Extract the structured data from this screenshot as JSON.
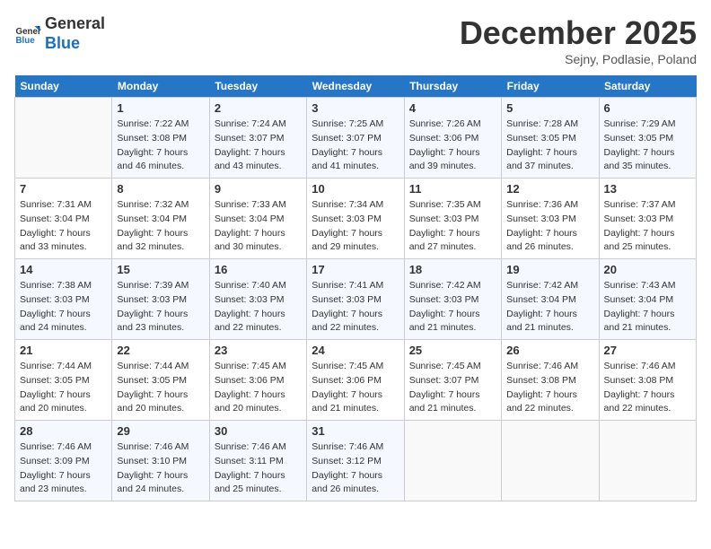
{
  "header": {
    "logo_line1": "General",
    "logo_line2": "Blue",
    "month": "December 2025",
    "location": "Sejny, Podlasie, Poland"
  },
  "days_of_week": [
    "Sunday",
    "Monday",
    "Tuesday",
    "Wednesday",
    "Thursday",
    "Friday",
    "Saturday"
  ],
  "weeks": [
    [
      {
        "day": "",
        "empty": true
      },
      {
        "day": "1",
        "sunrise": "7:22 AM",
        "sunset": "3:08 PM",
        "daylight": "7 hours and 46 minutes."
      },
      {
        "day": "2",
        "sunrise": "7:24 AM",
        "sunset": "3:07 PM",
        "daylight": "7 hours and 43 minutes."
      },
      {
        "day": "3",
        "sunrise": "7:25 AM",
        "sunset": "3:07 PM",
        "daylight": "7 hours and 41 minutes."
      },
      {
        "day": "4",
        "sunrise": "7:26 AM",
        "sunset": "3:06 PM",
        "daylight": "7 hours and 39 minutes."
      },
      {
        "day": "5",
        "sunrise": "7:28 AM",
        "sunset": "3:05 PM",
        "daylight": "7 hours and 37 minutes."
      },
      {
        "day": "6",
        "sunrise": "7:29 AM",
        "sunset": "3:05 PM",
        "daylight": "7 hours and 35 minutes."
      }
    ],
    [
      {
        "day": "7",
        "sunrise": "7:31 AM",
        "sunset": "3:04 PM",
        "daylight": "7 hours and 33 minutes."
      },
      {
        "day": "8",
        "sunrise": "7:32 AM",
        "sunset": "3:04 PM",
        "daylight": "7 hours and 32 minutes."
      },
      {
        "day": "9",
        "sunrise": "7:33 AM",
        "sunset": "3:04 PM",
        "daylight": "7 hours and 30 minutes."
      },
      {
        "day": "10",
        "sunrise": "7:34 AM",
        "sunset": "3:03 PM",
        "daylight": "7 hours and 29 minutes."
      },
      {
        "day": "11",
        "sunrise": "7:35 AM",
        "sunset": "3:03 PM",
        "daylight": "7 hours and 27 minutes."
      },
      {
        "day": "12",
        "sunrise": "7:36 AM",
        "sunset": "3:03 PM",
        "daylight": "7 hours and 26 minutes."
      },
      {
        "day": "13",
        "sunrise": "7:37 AM",
        "sunset": "3:03 PM",
        "daylight": "7 hours and 25 minutes."
      }
    ],
    [
      {
        "day": "14",
        "sunrise": "7:38 AM",
        "sunset": "3:03 PM",
        "daylight": "7 hours and 24 minutes."
      },
      {
        "day": "15",
        "sunrise": "7:39 AM",
        "sunset": "3:03 PM",
        "daylight": "7 hours and 23 minutes."
      },
      {
        "day": "16",
        "sunrise": "7:40 AM",
        "sunset": "3:03 PM",
        "daylight": "7 hours and 22 minutes."
      },
      {
        "day": "17",
        "sunrise": "7:41 AM",
        "sunset": "3:03 PM",
        "daylight": "7 hours and 22 minutes."
      },
      {
        "day": "18",
        "sunrise": "7:42 AM",
        "sunset": "3:03 PM",
        "daylight": "7 hours and 21 minutes."
      },
      {
        "day": "19",
        "sunrise": "7:42 AM",
        "sunset": "3:04 PM",
        "daylight": "7 hours and 21 minutes."
      },
      {
        "day": "20",
        "sunrise": "7:43 AM",
        "sunset": "3:04 PM",
        "daylight": "7 hours and 21 minutes."
      }
    ],
    [
      {
        "day": "21",
        "sunrise": "7:44 AM",
        "sunset": "3:05 PM",
        "daylight": "7 hours and 20 minutes."
      },
      {
        "day": "22",
        "sunrise": "7:44 AM",
        "sunset": "3:05 PM",
        "daylight": "7 hours and 20 minutes."
      },
      {
        "day": "23",
        "sunrise": "7:45 AM",
        "sunset": "3:06 PM",
        "daylight": "7 hours and 20 minutes."
      },
      {
        "day": "24",
        "sunrise": "7:45 AM",
        "sunset": "3:06 PM",
        "daylight": "7 hours and 21 minutes."
      },
      {
        "day": "25",
        "sunrise": "7:45 AM",
        "sunset": "3:07 PM",
        "daylight": "7 hours and 21 minutes."
      },
      {
        "day": "26",
        "sunrise": "7:46 AM",
        "sunset": "3:08 PM",
        "daylight": "7 hours and 22 minutes."
      },
      {
        "day": "27",
        "sunrise": "7:46 AM",
        "sunset": "3:08 PM",
        "daylight": "7 hours and 22 minutes."
      }
    ],
    [
      {
        "day": "28",
        "sunrise": "7:46 AM",
        "sunset": "3:09 PM",
        "daylight": "7 hours and 23 minutes."
      },
      {
        "day": "29",
        "sunrise": "7:46 AM",
        "sunset": "3:10 PM",
        "daylight": "7 hours and 24 minutes."
      },
      {
        "day": "30",
        "sunrise": "7:46 AM",
        "sunset": "3:11 PM",
        "daylight": "7 hours and 25 minutes."
      },
      {
        "day": "31",
        "sunrise": "7:46 AM",
        "sunset": "3:12 PM",
        "daylight": "7 hours and 26 minutes."
      },
      {
        "day": "",
        "empty": true
      },
      {
        "day": "",
        "empty": true
      },
      {
        "day": "",
        "empty": true
      }
    ]
  ]
}
